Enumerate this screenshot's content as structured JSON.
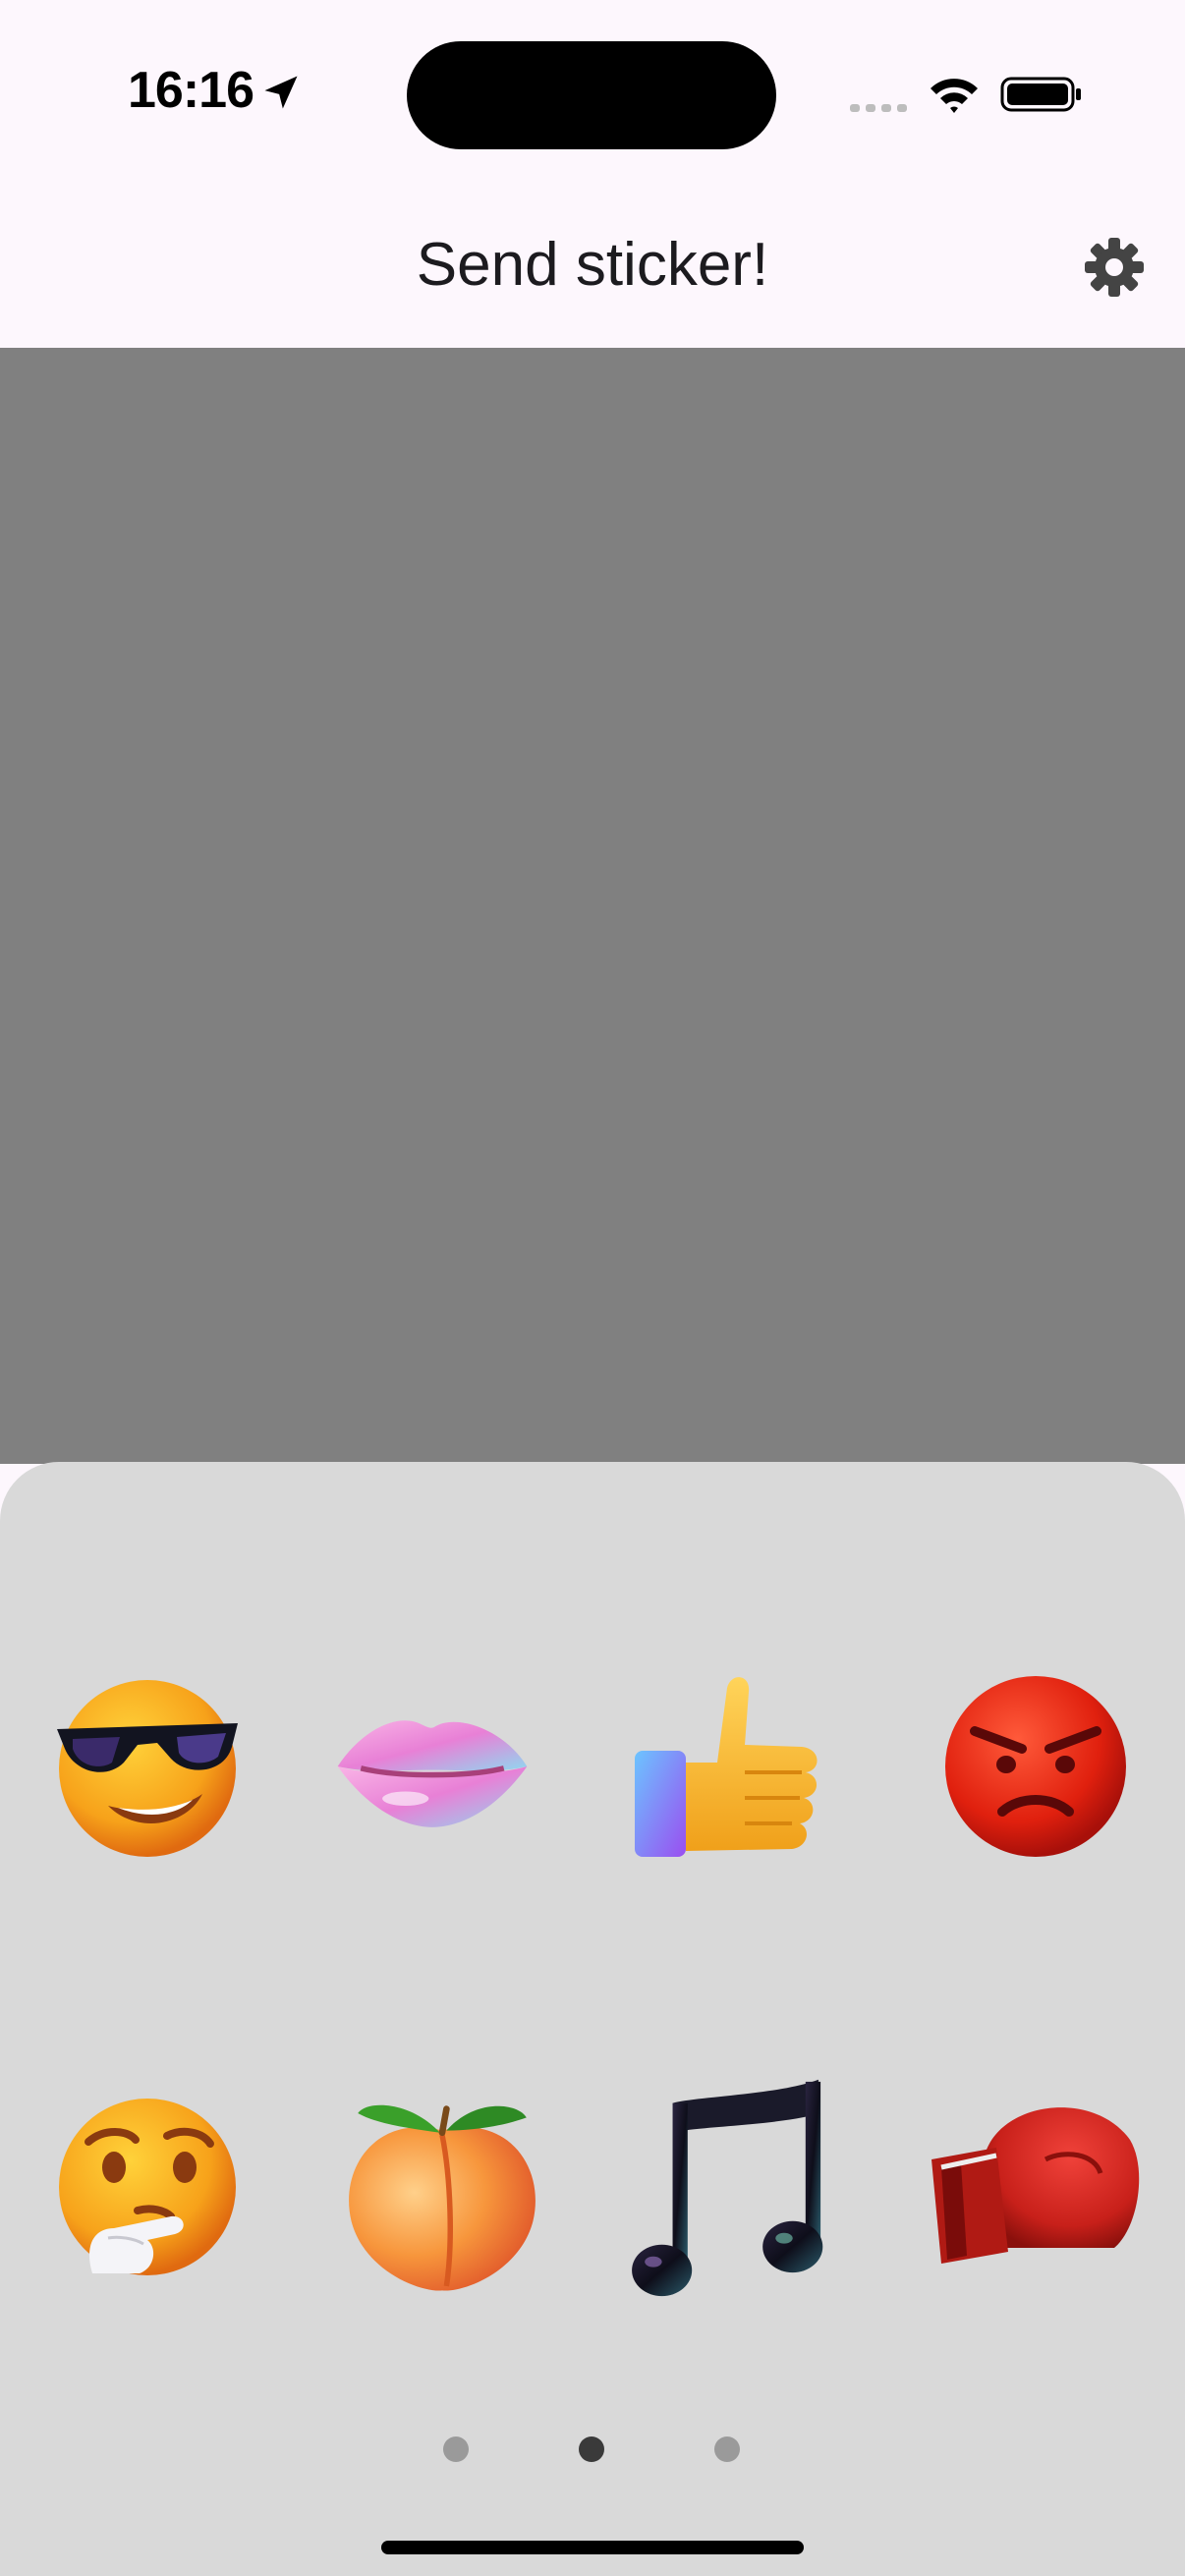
{
  "status_bar": {
    "time": "16:16"
  },
  "nav": {
    "title": "Send sticker!"
  },
  "stickers": [
    {
      "name": "sunglasses-face"
    },
    {
      "name": "lips"
    },
    {
      "name": "thumbs-up"
    },
    {
      "name": "angry-face"
    },
    {
      "name": "thinking-face"
    },
    {
      "name": "peach"
    },
    {
      "name": "music-note"
    },
    {
      "name": "boxing-glove"
    }
  ],
  "pager": {
    "pages": 3,
    "current": 2
  }
}
